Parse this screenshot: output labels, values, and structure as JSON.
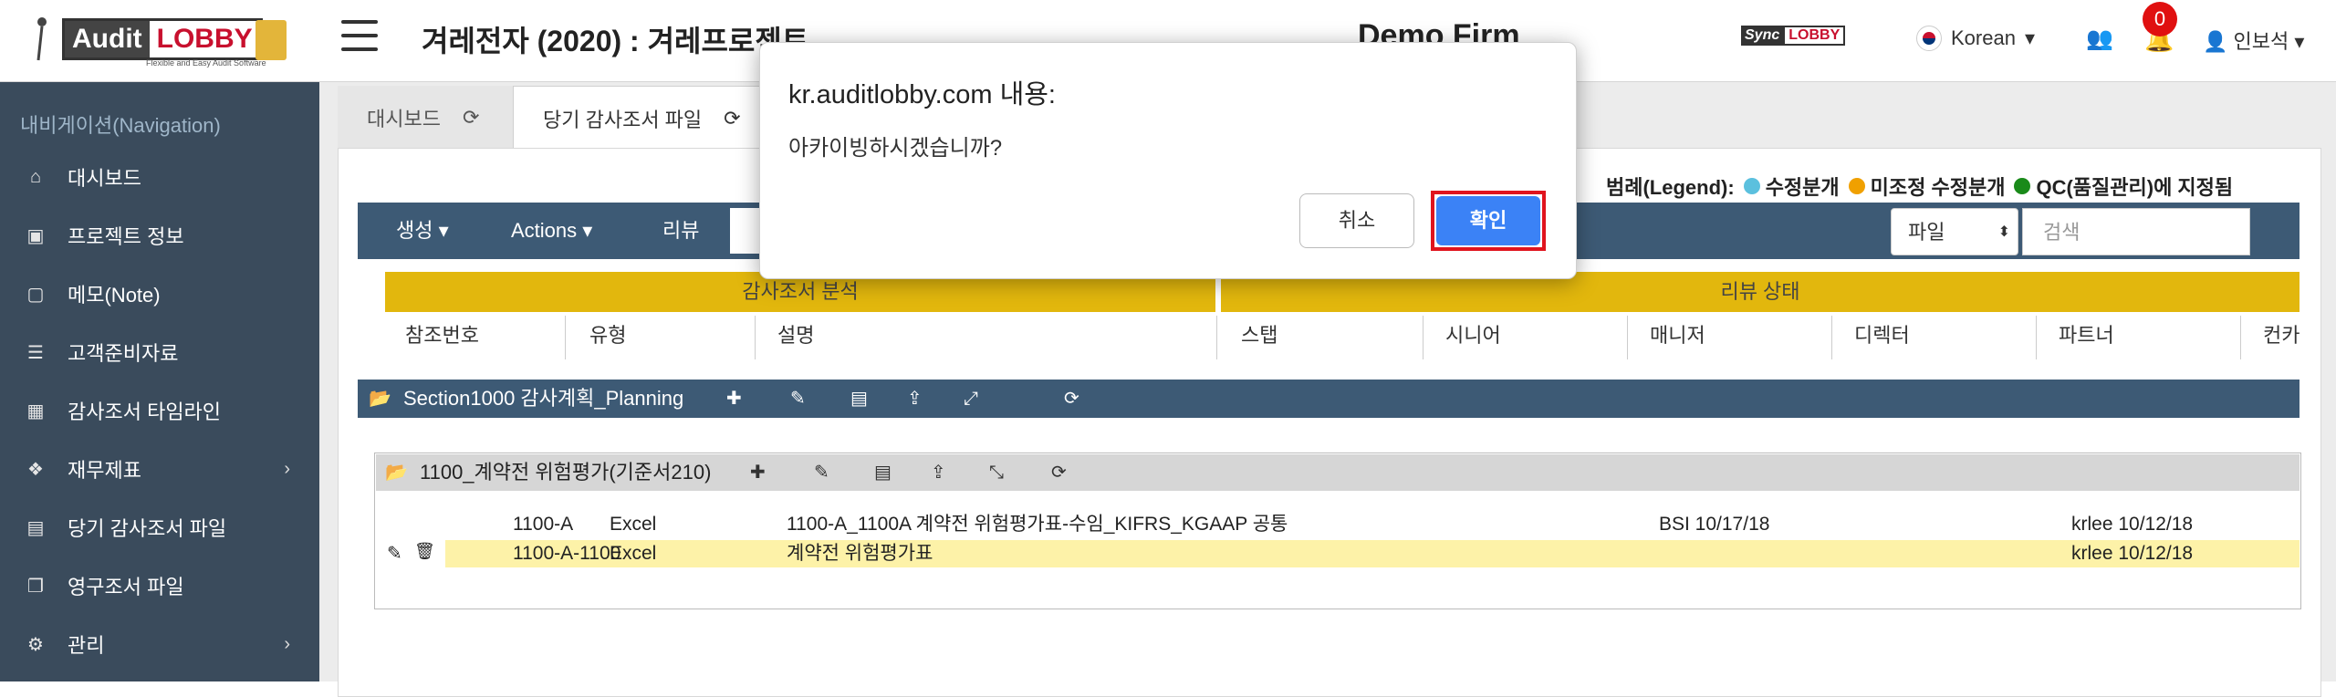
{
  "header": {
    "logo_audit": "Audit",
    "logo_lobby": "LOBBY",
    "logo_tagline": "Flexible and Easy Audit Software",
    "project_title": "겨레전자 (2020) : 겨레프로젝트",
    "firm": "Demo Firm",
    "sync_a": "Sync",
    "sync_b": "LOBBY",
    "language": "Korean",
    "notification_count": "0",
    "user_name": "인보석"
  },
  "sidebar": {
    "title": "내비게이션(Navigation)",
    "items": [
      {
        "label": "대시보드",
        "icon": "home-icon",
        "glyph": "⌂"
      },
      {
        "label": "프로젝트 정보",
        "icon": "id-card-icon",
        "glyph": "▣"
      },
      {
        "label": "메모(Note)",
        "icon": "note-icon",
        "glyph": "▢"
      },
      {
        "label": "고객준비자료",
        "icon": "list-icon",
        "glyph": "☰"
      },
      {
        "label": "감사조서 타임라인",
        "icon": "calendar-icon",
        "glyph": "▦"
      },
      {
        "label": "재무제표",
        "icon": "cubes-icon",
        "glyph": "❖"
      },
      {
        "label": "당기 감사조서 파일",
        "icon": "file-icon",
        "glyph": "▤"
      },
      {
        "label": "영구조서 파일",
        "icon": "clone-icon",
        "glyph": "❐"
      },
      {
        "label": "관리",
        "icon": "gear-icon",
        "glyph": "⚙"
      }
    ]
  },
  "tabs": [
    {
      "label": "대시보드"
    },
    {
      "label": "당기 감사조서 파일"
    }
  ],
  "legend": {
    "title": "범례(Legend):",
    "items": [
      {
        "label": "수정분개",
        "color": "#5bc0de"
      },
      {
        "label": "미조정 수정분개",
        "color": "#f0a000"
      },
      {
        "label": "QC(품질관리)에 지정됨",
        "color": "#1a8a1a"
      }
    ]
  },
  "toolbar": {
    "create": "생성",
    "actions": "Actions",
    "review": "리뷰",
    "type_select": "파일",
    "search_placeholder": "검색"
  },
  "table": {
    "group_left": "감사조서 분석",
    "group_right": "리뷰 상태",
    "columns": [
      "참조번호",
      "유형",
      "설명",
      "스탭",
      "시니어",
      "매니저",
      "디렉터",
      "파트너",
      "컨카"
    ]
  },
  "section": {
    "title": "Section1000 감사계획_Planning",
    "sub_title": "1100_계약전 위험평가(기준서210)"
  },
  "rows": [
    {
      "ref": "1100-A",
      "type": "Excel",
      "desc": "1100-A_1100A 계약전 위험평가표-수임_KIFRS_KGAAP 공통",
      "manager": "BSI 10/17/18",
      "partner": "krlee 10/12/18"
    },
    {
      "ref": "1100-A-1100",
      "type": "Excel",
      "desc": "계약전 위험평가표",
      "manager": "",
      "partner": "krlee 10/12/18"
    }
  ],
  "dialog": {
    "title": "kr.auditlobby.com 내용:",
    "message": "아카이빙하시겠습니까?",
    "cancel": "취소",
    "ok": "확인"
  },
  "colors": {
    "sidebar": "#3a4b5c",
    "toolbar": "#3d5a75",
    "gold": "#e2b70d",
    "ok_button": "#3b82f6",
    "highlight": "#fdf2a8"
  }
}
